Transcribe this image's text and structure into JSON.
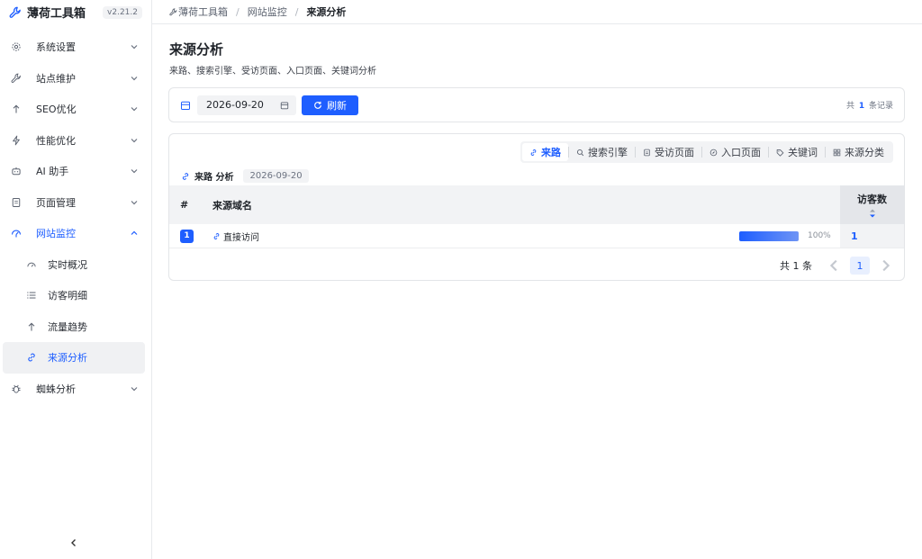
{
  "app": {
    "title": "薄荷工具箱",
    "version": "v2.21.2"
  },
  "sidebar": {
    "items": [
      {
        "label": "系统设置",
        "icon": "gear-icon"
      },
      {
        "label": "站点维护",
        "icon": "wrench-icon"
      },
      {
        "label": "SEO优化",
        "icon": "arrow-up-icon"
      },
      {
        "label": "性能优化",
        "icon": "bolt-icon"
      },
      {
        "label": "AI 助手",
        "icon": "robot-icon"
      },
      {
        "label": "页面管理",
        "icon": "page-icon"
      },
      {
        "label": "网站监控",
        "icon": "monitor-icon",
        "expanded": true,
        "children": [
          {
            "label": "实时概况",
            "icon": "gauge-icon"
          },
          {
            "label": "访客明细",
            "icon": "list-icon"
          },
          {
            "label": "流量趋势",
            "icon": "arrow-up-icon"
          },
          {
            "label": "来源分析",
            "icon": "link-icon",
            "active": true
          }
        ]
      },
      {
        "label": "蜘蛛分析",
        "icon": "bug-icon"
      }
    ]
  },
  "breadcrumb": {
    "root": "薄荷工具箱",
    "parent": "网站监控",
    "current": "来源分析",
    "separator": "/"
  },
  "page": {
    "title": "来源分析",
    "subtitle": "来路、搜索引擎、受访页面、入口页面、关键词分析"
  },
  "filter": {
    "date": "2026-09-20",
    "refresh_label": "刷新",
    "record_prefix": "共",
    "record_count": "1",
    "record_suffix": "条记录"
  },
  "tabs": [
    {
      "label": "来路",
      "icon": "link-icon",
      "active": true
    },
    {
      "label": "搜索引擎",
      "icon": "search-icon"
    },
    {
      "label": "受访页面",
      "icon": "file-icon"
    },
    {
      "label": "入口页面",
      "icon": "compass-icon"
    },
    {
      "label": "关键词",
      "icon": "tag-icon"
    },
    {
      "label": "来源分类",
      "icon": "grid-icon"
    }
  ],
  "section": {
    "label": "来路 分析",
    "date": "2026-09-20"
  },
  "table": {
    "headers": {
      "index": "#",
      "domain": "来源域名",
      "visits": "访客数"
    },
    "rows": [
      {
        "index": "1",
        "domain": "直接访问",
        "share": 100,
        "share_label": "100%",
        "visits": "1"
      }
    ]
  },
  "pagination": {
    "total": "共 1 条",
    "current_page": "1"
  },
  "colors": {
    "accent": "#1e5eff"
  }
}
